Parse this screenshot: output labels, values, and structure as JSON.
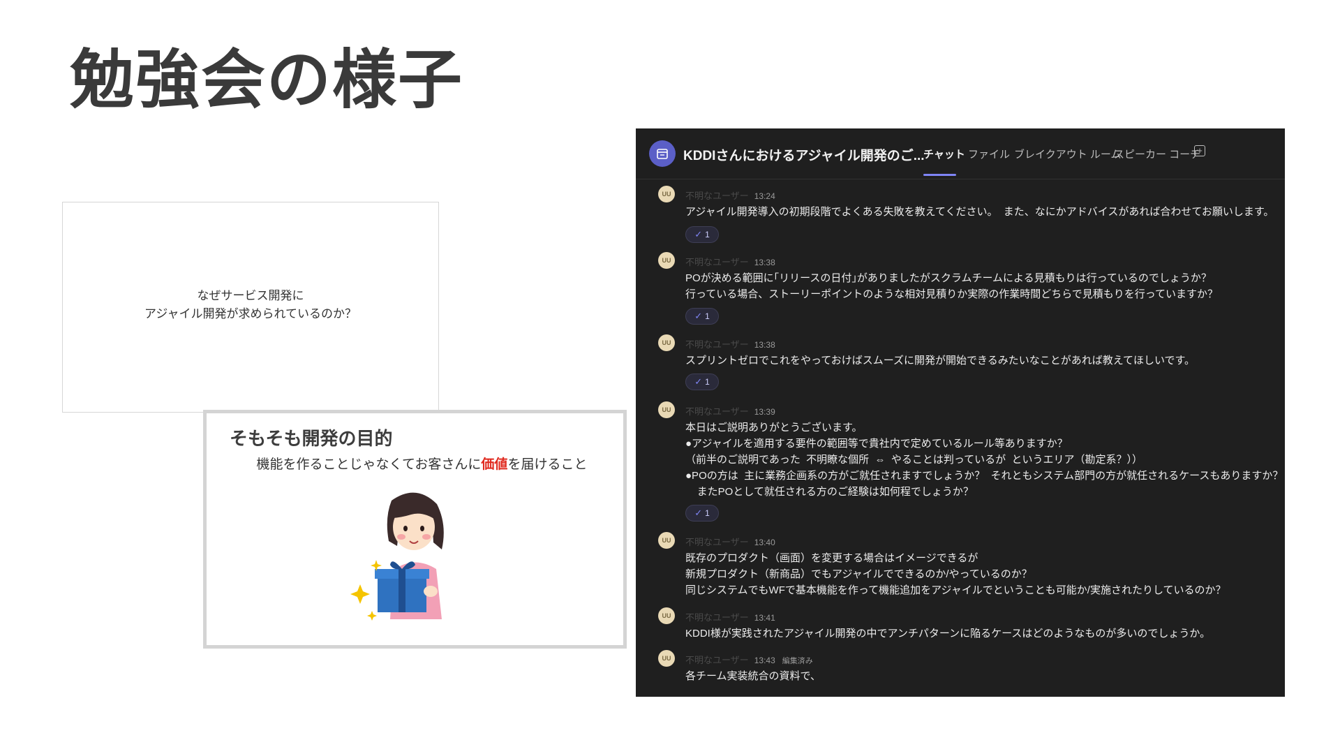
{
  "page": {
    "title": "勉強会の様子"
  },
  "slide1": {
    "line1": "なぜサービス開発に",
    "line2": "アジャイル開発が求められているのか？"
  },
  "slide2": {
    "title": "そもそも開発の目的",
    "message_before": "機能を作ることじゃなくてお客さんに",
    "message_highlight": "価値",
    "message_after": "を届けること",
    "highlight_color": "#e02a1f"
  },
  "chat": {
    "meeting_title": "KDDIさんにおけるアジャイル開発のご...",
    "tabs": [
      "チャット",
      "ファイル",
      "ブレイクアウト ルーム",
      "スピーカー コーチ"
    ],
    "active_tab": "チャット",
    "accent_color": "#7f85f5",
    "messages": [
      {
        "avatar": "UU",
        "user": "不明なユーザー",
        "time": "13:24",
        "edited": "",
        "text": "アジャイル開発導入の初期段階でよくある失敗を教えてください。  また、なにかアドバイスがあれば合わせてお願いします。",
        "reaction_count": "1"
      },
      {
        "avatar": "UU",
        "user": "不明なユーザー",
        "time": "13:38",
        "edited": "",
        "text": "POが決める範囲に｢リリースの日付｣がありましたがスクラムチームによる見積もりは行っているのでしょうか？\n行っている場合、ストーリーポイントのような相対見積りか実際の作業時間どちらで見積もりを行っていますか？",
        "reaction_count": "1"
      },
      {
        "avatar": "UU",
        "user": "不明なユーザー",
        "time": "13:38",
        "edited": "",
        "text": "スプリントゼロでこれをやっておけばスムーズに開発が開始できるみたいなことがあれば教えてほしいです。",
        "reaction_count": "1"
      },
      {
        "avatar": "UU",
        "user": "不明なユーザー",
        "time": "13:39",
        "edited": "",
        "text": "本日はご説明ありがとうございます。\n●アジャイルを適用する要件の範囲等で貴社内で定めているルール等ありますか？\n（前半のご説明であった  不明瞭な個所  ⇔  やることは判っているが  というエリア（勘定系？））\n●POの方は  主に業務企画系の方がご就任されますでしょうか？  それともシステム部門の方が就任されるケースもありますか？\n    またPOとして就任される方のご経験は如何程でしょうか？",
        "reaction_count": "1"
      },
      {
        "avatar": "UU",
        "user": "不明なユーザー",
        "time": "13:40",
        "edited": "",
        "text": "既存のプロダクト（画面）を変更する場合はイメージできるが\n新規プロダクト（新商品）でもアジャイルでできるのか/やっているのか？\n同じシステムでもWFで基本機能を作って機能追加をアジャイルでということも可能か/実施されたりしているのか？",
        "reaction_count": ""
      },
      {
        "avatar": "UU",
        "user": "不明なユーザー",
        "time": "13:41",
        "edited": "",
        "text": "KDDI様が実践されたアジャイル開発の中でアンチパターンに陥るケースはどのようなものが多いのでしょうか。",
        "reaction_count": ""
      },
      {
        "avatar": "UU",
        "user": "不明なユーザー",
        "time": "13:43",
        "edited": "編集済み",
        "text": "各チーム実装統合の資料で、",
        "reaction_count": ""
      }
    ]
  }
}
